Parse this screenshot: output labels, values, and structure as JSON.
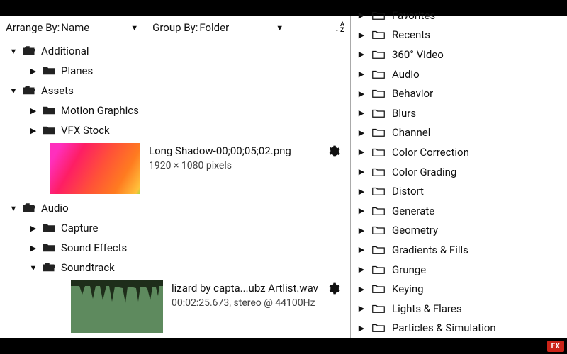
{
  "controls": {
    "arrange_label": "Arrange By:",
    "arrange_value": "Name",
    "group_label": "Group By:",
    "group_value": "Folder"
  },
  "tree": {
    "additional": {
      "name": "Additional"
    },
    "planes": {
      "name": "Planes"
    },
    "assets": {
      "name": "Assets"
    },
    "motion_graphics": {
      "name": "Motion Graphics"
    },
    "vfx_stock": {
      "name": "VFX Stock"
    },
    "audio": {
      "name": "Audio"
    },
    "capture": {
      "name": "Capture"
    },
    "sound_effects": {
      "name": "Sound Effects"
    },
    "soundtrack": {
      "name": "Soundtrack"
    }
  },
  "assets": {
    "png": {
      "title": "Long Shadow-00;00;05;02.png",
      "sub": "1920 × 1080 pixels"
    },
    "wav": {
      "title": "lizard by capta...ubz Artlist.wav",
      "sub": "00:02:25.673, stereo @ 44100Hz"
    }
  },
  "effects": [
    "Favorites",
    "Recents",
    "360° Video",
    "Audio",
    "Behavior",
    "Blurs",
    "Channel",
    "Color Correction",
    "Color Grading",
    "Distort",
    "Generate",
    "Geometry",
    "Gradients & Fills",
    "Grunge",
    "Keying",
    "Lights & Flares",
    "Particles & Simulation"
  ],
  "badge": "FX"
}
